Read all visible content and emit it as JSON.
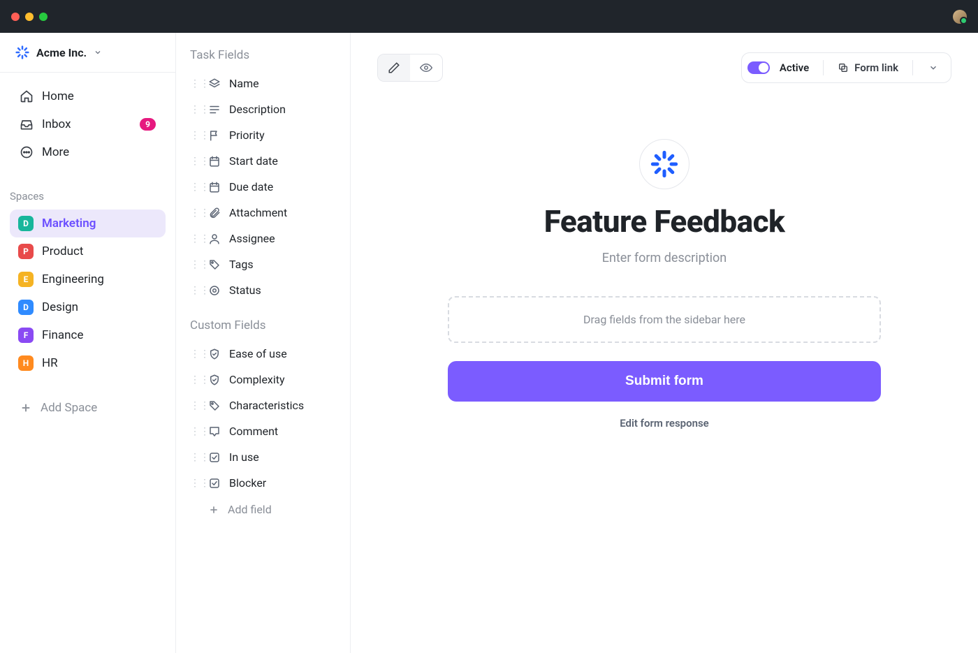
{
  "workspace": {
    "name": "Acme Inc."
  },
  "nav": {
    "home": "Home",
    "inbox": "Inbox",
    "inbox_badge": "9",
    "more": "More"
  },
  "spaces": {
    "label": "Spaces",
    "items": [
      {
        "letter": "D",
        "name": "Marketing",
        "color": "#18b69b",
        "active": true
      },
      {
        "letter": "P",
        "name": "Product",
        "color": "#e84a4a",
        "active": false
      },
      {
        "letter": "E",
        "name": "Engineering",
        "color": "#f5b323",
        "active": false
      },
      {
        "letter": "D",
        "name": "Design",
        "color": "#2f8bff",
        "active": false
      },
      {
        "letter": "F",
        "name": "Finance",
        "color": "#8a4af3",
        "active": false
      },
      {
        "letter": "H",
        "name": "HR",
        "color": "#ff8a1f",
        "active": false
      }
    ],
    "add": "Add Space"
  },
  "fields": {
    "task_label": "Task Fields",
    "task": [
      {
        "name": "Name",
        "icon": "layers"
      },
      {
        "name": "Description",
        "icon": "text"
      },
      {
        "name": "Priority",
        "icon": "flag"
      },
      {
        "name": "Start date",
        "icon": "calendar"
      },
      {
        "name": "Due date",
        "icon": "calendar"
      },
      {
        "name": "Attachment",
        "icon": "clip"
      },
      {
        "name": "Assignee",
        "icon": "person"
      },
      {
        "name": "Tags",
        "icon": "tag"
      },
      {
        "name": "Status",
        "icon": "target"
      }
    ],
    "custom_label": "Custom Fields",
    "custom": [
      {
        "name": "Ease of use",
        "icon": "shield"
      },
      {
        "name": "Complexity",
        "icon": "shield"
      },
      {
        "name": "Characteristics",
        "icon": "tag"
      },
      {
        "name": "Comment",
        "icon": "comment"
      },
      {
        "name": "In use",
        "icon": "check"
      },
      {
        "name": "Blocker",
        "icon": "check"
      }
    ],
    "add": "Add field"
  },
  "toolbar": {
    "active_label": "Active",
    "form_link_label": "Form link"
  },
  "form": {
    "title": "Feature Feedback",
    "description_placeholder": "Enter form description",
    "dropzone": "Drag fields from the sidebar here",
    "submit": "Submit form",
    "edit_response": "Edit form response"
  }
}
